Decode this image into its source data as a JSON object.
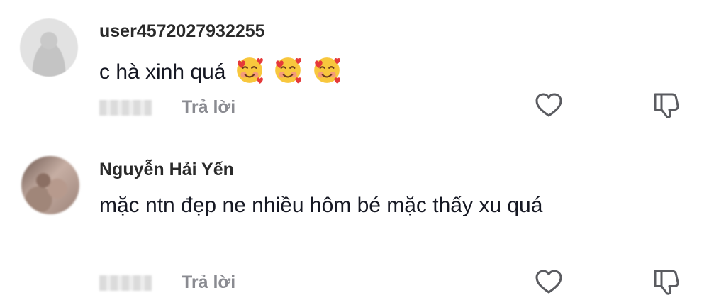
{
  "comments": [
    {
      "username": "user4572027932255",
      "text": "c hà xinh quá",
      "emoji": "smiling-face-with-hearts",
      "reply_label": "Trả lời"
    },
    {
      "username": "Nguyễn Hải Yến",
      "text": "mặc ntn đẹp ne nhiều hôm bé mặc thấy xu quá",
      "reply_label": "Trả lời"
    }
  ],
  "colors": {
    "text": "#161823",
    "meta": "#8a8b91"
  }
}
